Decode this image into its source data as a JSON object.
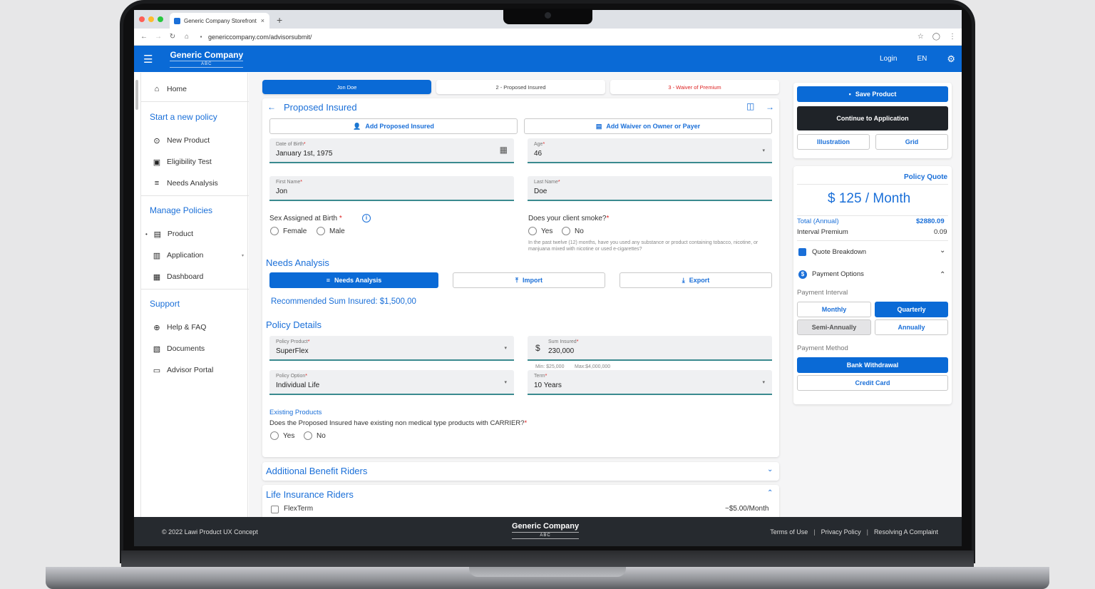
{
  "browser": {
    "tab_title": "Generic Company Storefront",
    "tab_close": "×",
    "new_tab": "+",
    "url": "genericcompany.com/advisorsubmit/"
  },
  "header": {
    "brand_name": "Generic Company",
    "brand_sub": "ABC",
    "login": "Login",
    "language": "EN"
  },
  "sidebar": {
    "home": "Home",
    "section_start": "Start a new policy",
    "new_product": "New Product",
    "eligibility_test": "Eligibility Test",
    "needs_analysis": "Needs Analysis",
    "section_manage": "Manage Policies",
    "product": "Product",
    "application": "Application",
    "dashboard": "Dashboard",
    "section_support": "Support",
    "help_faq": "Help & FAQ",
    "documents": "Documents",
    "advisor_portal": "Advisor Portal"
  },
  "steps": {
    "step1": "Jon Doe",
    "step2": "2 - Proposed Insured",
    "step3": "3 - Waiver of Premium"
  },
  "proposed": {
    "title": "Proposed Insured",
    "add_insured": "Add Proposed Insured",
    "add_waiver": "Add Waiver on Owner or Payer",
    "dob_label": "Date of Birth",
    "dob_value": "January 1st, 1975",
    "age_label": "Age",
    "age_value": "46",
    "first_label": "First Name",
    "first_value": "Jon",
    "last_label": "Last Name",
    "last_value": "Doe",
    "sex_label": "Sex Assigned at Birth",
    "female": "Female",
    "male": "Male",
    "smoke_label": "Does your client smoke?",
    "yes": "Yes",
    "no": "No",
    "smoke_hint": "In the past twelve (12) months, have you used any substance or product containing tobacco, nicotine, or manjuana mixed with nicotine or used e-cigarettes?",
    "required_mark": "*"
  },
  "needs": {
    "title": "Needs Analysis",
    "btn_needs": "Needs Analysis",
    "btn_import": "Import",
    "btn_export": "Export",
    "recommended": "Recommended Sum Insured: $1,500,00"
  },
  "policy": {
    "title": "Policy Details",
    "product_label": "Policy Product",
    "product_value": "SuperFlex",
    "sum_label": "Sum Insured",
    "sum_prefix": "$",
    "sum_value": "230,000",
    "sum_min": "Min: $25,000",
    "sum_max": "Max:$4,000,000",
    "option_label": "Policy Option",
    "option_value": "Individual Life",
    "term_label": "Term",
    "term_value": "10 Years",
    "existing_title": "Existing Products",
    "existing_q": "Does the Proposed Insured have existing non medical type products with CARRIER?"
  },
  "riders": {
    "additional": "Additional Benefit Riders",
    "life": "Life Insurance Riders",
    "flexterm": "FlexTerm",
    "flexterm_price": "~$5.00/Month"
  },
  "right": {
    "save": "Save Product",
    "continue": "Continue to Application",
    "illustration": "Illustration",
    "grid": "Grid",
    "quote_title": "Policy Quote",
    "quote_amount": "$ 125 / Month",
    "total_label": "Total (Annual)",
    "total_value": "$2880.09",
    "interval_label": "Interval Premium",
    "interval_value": "0.09",
    "breakdown": "Quote Breakdown",
    "payment_options": "Payment Options",
    "payment_interval": "Payment Interval",
    "monthly": "Monthly",
    "quarterly": "Quarterly",
    "semi": "Semi-Annually",
    "annually": "Annually",
    "payment_method": "Payment Method",
    "bank": "Bank Withdrawal",
    "card": "Credit Card"
  },
  "footer": {
    "copyright": "© 2022 Lawi Product UX Concept",
    "brand_name": "Generic Company",
    "brand_sub": "ABC",
    "terms": "Terms of Use",
    "privacy": "Privacy Policy",
    "complaint": "Resolving A Complaint",
    "separator": "|"
  },
  "colors": {
    "brand_blue": "#0a6ad6",
    "dark_button": "#1f2328",
    "footer_bg": "#262a2f",
    "error_red": "#d22222"
  }
}
